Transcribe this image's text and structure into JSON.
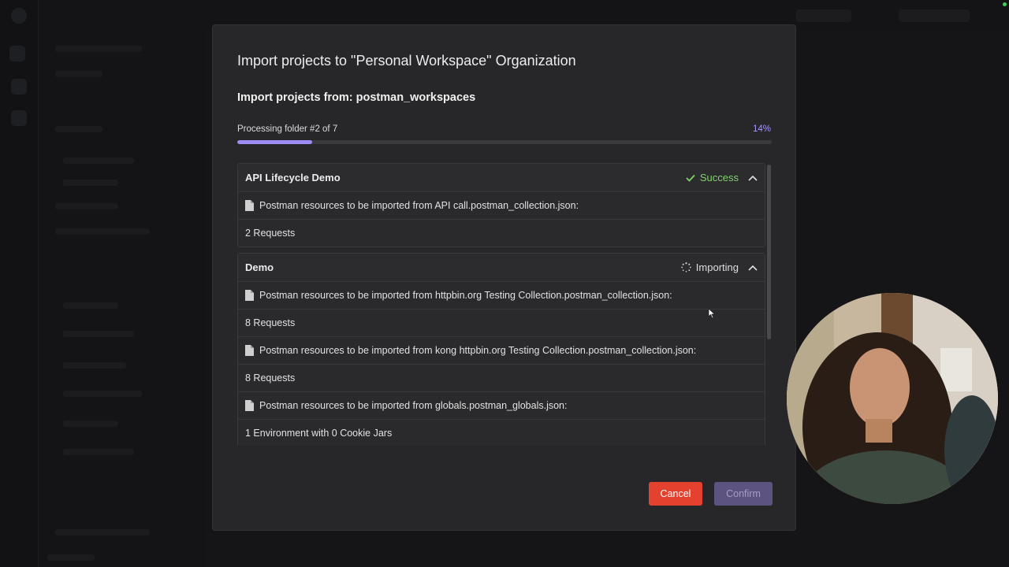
{
  "dialog": {
    "title": "Import projects to \"Personal Workspace\" Organization",
    "subtitle": "Import projects from: postman_workspaces",
    "progress": {
      "label": "Processing folder #2 of 7",
      "percent_text": "14%",
      "fraction": 0.14,
      "accent": "#9d8cf5"
    },
    "groups": [
      {
        "name": "API Lifecycle Demo",
        "status": "Success",
        "status_icon": "check-icon",
        "rows": [
          {
            "text": "Postman resources to be imported from API call.postman_collection.json:",
            "icon": "file-icon"
          },
          {
            "text": "2 Requests"
          }
        ]
      },
      {
        "name": "Demo",
        "status": "Importing",
        "status_icon": "spinner-icon",
        "rows": [
          {
            "text": "Postman resources to be imported from httpbin.org Testing Collection.postman_collection.json:",
            "icon": "file-icon"
          },
          {
            "text": "8 Requests"
          },
          {
            "text": "Postman resources to be imported from kong httpbin.org Testing Collection.postman_collection.json:",
            "icon": "file-icon"
          },
          {
            "text": "8 Requests"
          },
          {
            "text": "Postman resources to be imported from globals.postman_globals.json:",
            "icon": "file-icon"
          },
          {
            "text": "1 Environment with 0 Cookie Jars"
          }
        ]
      }
    ],
    "buttons": {
      "cancel": "Cancel",
      "confirm": "Confirm"
    },
    "colors": {
      "success": "#7fd468",
      "cancel": "#e4422f",
      "confirm_disabled": "#5c5380"
    }
  }
}
